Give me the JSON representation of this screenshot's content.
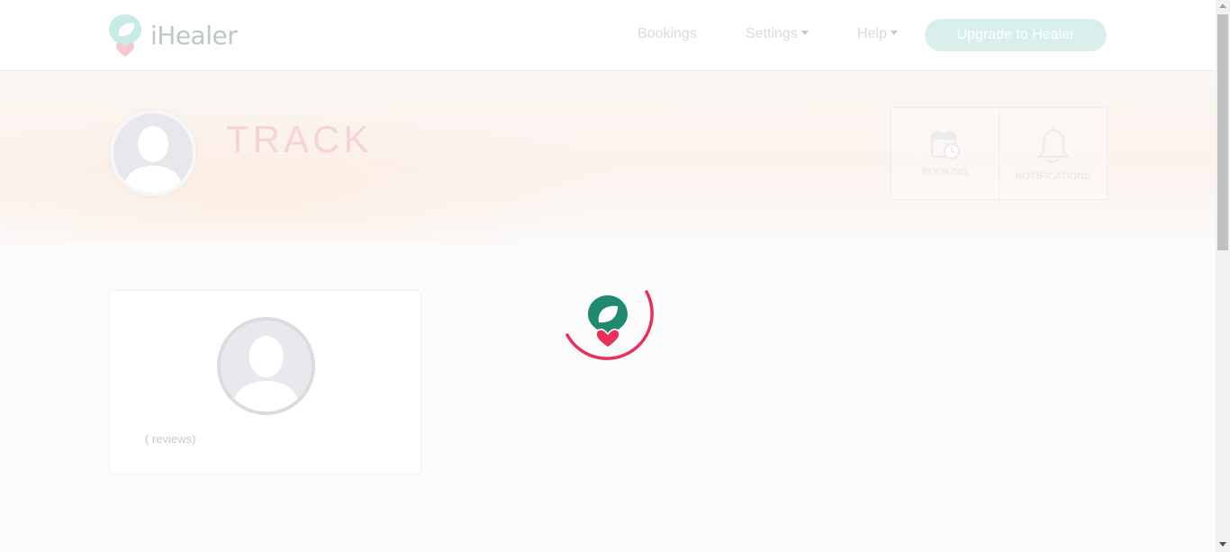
{
  "brand": {
    "name": "iHealer",
    "icon": "ihealer-logo-icon"
  },
  "nav": {
    "bookings": "Bookings",
    "settings": "Settings",
    "help": "Help",
    "upgrade": "Upgrade to Healer"
  },
  "hero": {
    "title": "TRACK",
    "quick_links": [
      {
        "label": "BOOKING",
        "icon": "calendar-clock-icon"
      },
      {
        "label": "NOTIFICATIONS",
        "icon": "bell-icon"
      }
    ]
  },
  "profile_card": {
    "reviews": "( reviews)"
  },
  "colors": {
    "brand_green": "#1f8a70",
    "brand_pink": "#e8305a",
    "title_pink": "#f6d3d8",
    "upgrade_bg": "#d9efec"
  }
}
